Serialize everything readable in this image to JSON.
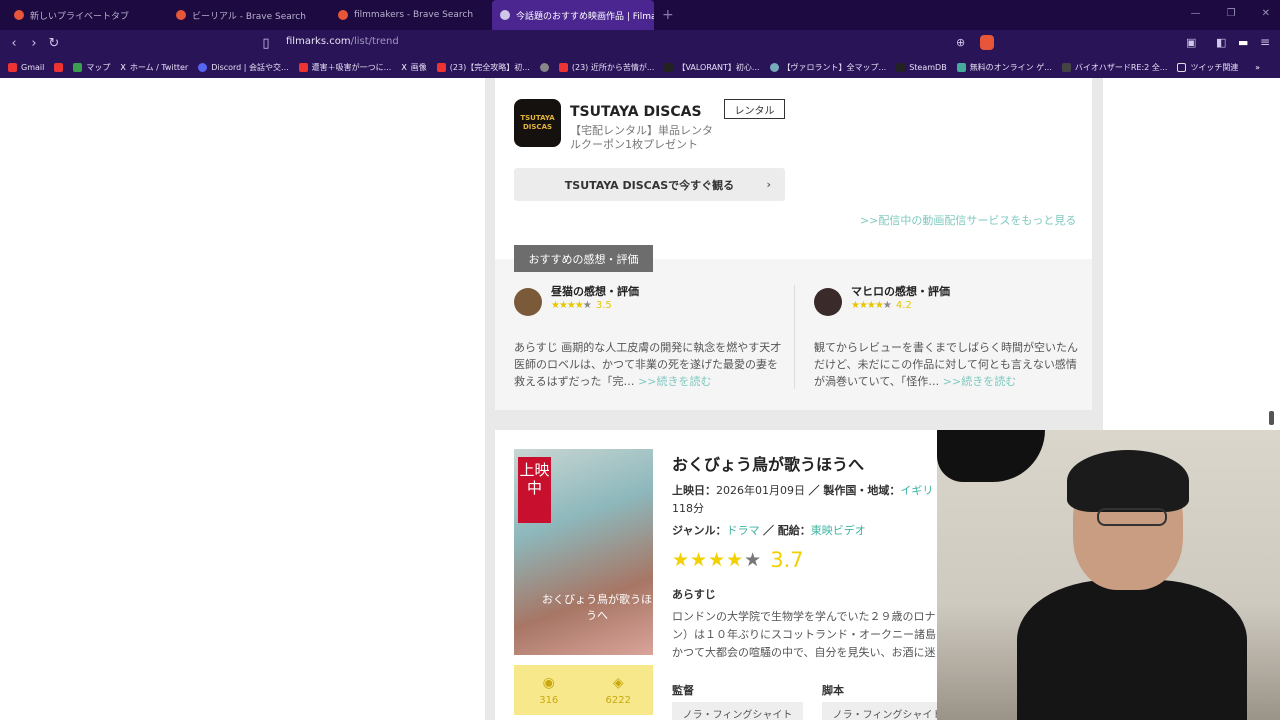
{
  "browser": {
    "tabs": [
      {
        "title": "新しいプライベートタブ"
      },
      {
        "title": "ビーリアル - Brave Search"
      },
      {
        "title": "filmmakers - Brave Search"
      },
      {
        "title": "今話題のおすすめ映画作品 | Filma"
      }
    ],
    "url_domain": "filmarks.com",
    "url_path": "/list/trend",
    "bookmarks": [
      "Gmail",
      "マップ",
      "ホーム / Twitter",
      "Discord | 会話や交...",
      "遭害＋吸害が一つに...",
      "画像",
      "(23)【完全攻略】初...",
      "(23) 近所から苦情が...",
      "【VALORANT】初心...",
      "【ヴァロラント】全マップ...",
      "SteamDB",
      "無料のオンライン ゲ...",
      "バイオハザードRE:2 全...",
      "ツイッチ関連"
    ]
  },
  "service": {
    "logo_text": "TSUTAYA DISCAS",
    "name": "TSUTAYA DISCAS",
    "desc": "【宅配レンタル】単品レンタルクーポン1枚プレゼント",
    "badge": "レンタル",
    "watch_button": "TSUTAYA DISCASで今すぐ観る",
    "more_link": ">>配信中の動画配信サービスをもっと見る"
  },
  "reviews": {
    "tag": "おすすめの感想・評価",
    "items": [
      {
        "name": "昼猫の感想・評価",
        "score": "3.5",
        "text": "あらすじ 画期的な人工皮膚の開発に執念を燃やす天才医師のロベルは、かつて非業の死を遂げた最愛の妻を救えるはずだった「完…",
        "read_more": ">>続きを読む"
      },
      {
        "name": "マヒロの感想・評価",
        "score": "4.2",
        "text": "観てからレビューを書くまでしばらく時間が空いたんだけど、未だにこの作品に対して何とも言えない感情が渦巻いていて、「怪作…",
        "read_more": ">>続きを読む"
      }
    ]
  },
  "movie": {
    "ribbon": "上映中",
    "poster_title": "おくびょう鳥が歌うほうへ",
    "title": "おくびょう鳥が歌うほうへ",
    "release_label": "上映日：",
    "release": "2026年01月09日",
    "country_label": "／ 製作国・地域：",
    "country": "イギリ",
    "runtime": "118分",
    "genre_label": "ジャンル：",
    "genre": "ドラマ",
    "distributor_label": "／ 配給：",
    "distributor": "東映ビデオ",
    "rating": "3.7",
    "stars": "★★★★★",
    "synopsis_heading": "あらすじ",
    "synopsis_lines": [
      "ロンドンの大学院で生物学を学んでいた２９歳のロナ",
      "ン）は１０年ぶりにスコットランド・オークニー諸島",
      "かつて大都会の喧騒の中で、自分を見失い、お酒に迷"
    ],
    "watched": "316",
    "clipped": "6222",
    "director_heading": "監督",
    "writer_heading": "脚本",
    "director": "ノラ・フィングシャイト",
    "writer": "ノラ・フィングシャイト"
  }
}
